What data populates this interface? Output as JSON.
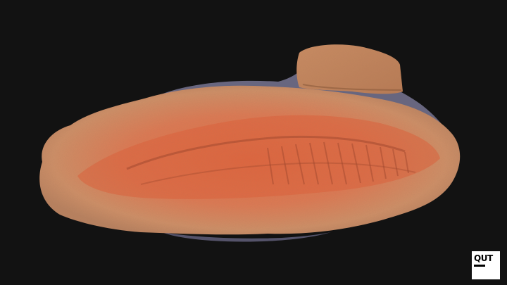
{
  "scene": {
    "background_color": "#121212",
    "subject": "fossil-slab-3d-scan",
    "colors": {
      "rock_outer": "#c98a62",
      "rock_inner": "#e0764e",
      "rock_dark": "#a2452b",
      "pedestal": "#6e6c86"
    }
  },
  "logo": {
    "text": "QUT",
    "background_color": "#ffffff",
    "text_color": "#000000"
  }
}
